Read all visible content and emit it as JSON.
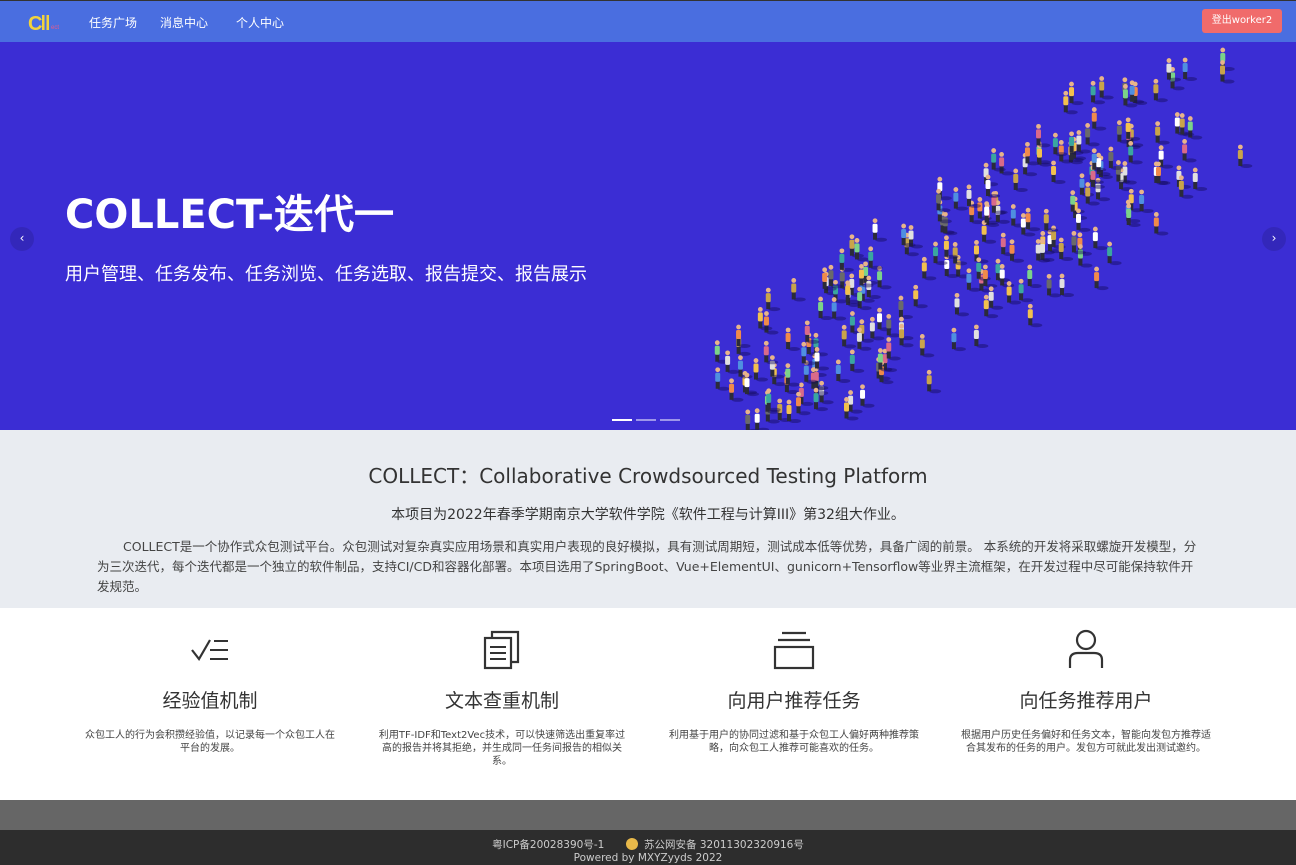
{
  "nav": {
    "logo_text": "CII",
    "items": [
      {
        "label": "任务广场"
      },
      {
        "label": "消息中心"
      },
      {
        "label": "个人中心"
      }
    ],
    "logout_label": "登出worker2"
  },
  "banner": {
    "title": "COLLECT-迭代一",
    "subtitle": "用户管理、任务发布、任务浏览、任务选取、报告提交、报告展示",
    "prev_icon": "‹",
    "next_icon": "›",
    "slide_count": 3,
    "active_slide": 1
  },
  "intro": {
    "title": "COLLECT：Collaborative Crowdsourced Testing Platform",
    "subtitle": "本项目为2022年春季学期南京大学软件学院《软件工程与计算III》第32组大作业。",
    "body": "COLLECT是一个协作式众包测试平台。众包测试对复杂真实应用场景和真实用户表现的良好模拟，具有测试周期短，测试成本低等优势，具备广阔的前景。 本系统的开发将采取螺旋开发模型，分为三次迭代，每个迭代都是一个独立的软件制品，支持CI/CD和容器化部署。本项目选用了SpringBoot、Vue+ElementUI、gunicorn+Tensorflow等业界主流框架，在开发过程中尽可能保持软件开发规范。"
  },
  "features": [
    {
      "icon": "checklist-icon",
      "title": "经验值机制",
      "desc": "众包工人的行为会积攒经验值，以记录每一个众包工人在平台的发展。"
    },
    {
      "icon": "document-copy-icon",
      "title": "文本查重机制",
      "desc": "利用TF-IDF和Text2Vec技术，可以快速筛选出重复率过高的报告并将其拒绝，并生成同一任务间报告的相似关系。"
    },
    {
      "icon": "stack-icon",
      "title": "向用户推荐任务",
      "desc": "利用基于用户的协同过滤和基于众包工人偏好两种推荐策略，向众包工人推荐可能喜欢的任务。"
    },
    {
      "icon": "user-icon",
      "title": "向任务推荐用户",
      "desc": "根据用户历史任务偏好和任务文本，智能向发包方推荐适合其发布的任务的用户。发包方可就此发出测试邀约。"
    }
  ],
  "footer": {
    "icp": "粤ICP备20028390号-1",
    "police": "苏公网安备 32011302320916号",
    "powered": "Powered by MXYZyyds 2022"
  },
  "colors": {
    "nav_bg": "#4a6ee0",
    "banner_bg": "#3b2dd4",
    "logout_bg": "#f06b6b",
    "intro_bg": "#e9ecf1",
    "footer_bg": "#2d2d2d"
  }
}
